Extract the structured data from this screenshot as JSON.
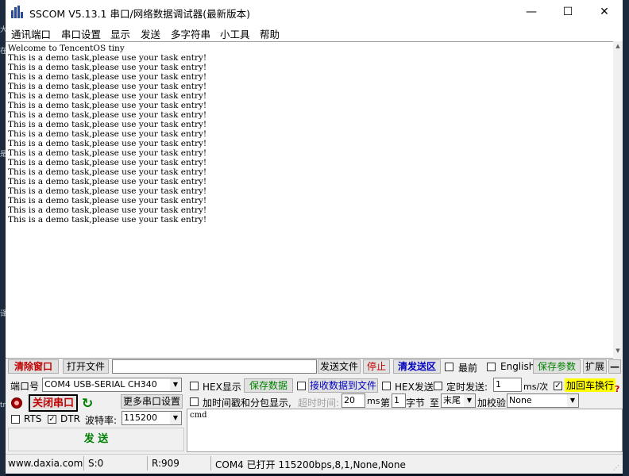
{
  "window": {
    "title": "SSCOM V5.13.1 串口/网络数据调试器(最新版本)",
    "minimize_glyph": "—",
    "maximize_glyph": "☐",
    "close_glyph": "✕"
  },
  "menu": [
    "通讯端口",
    "串口设置",
    "显示",
    "发送",
    "多字符串",
    "小工具",
    "帮助"
  ],
  "terminal": {
    "lines": [
      "Welcome to TencentOS tiny",
      "This is a demo task,please use your task entry!",
      "This is a demo task,please use your task entry!",
      "This is a demo task,please use your task entry!",
      "This is a demo task,please use your task entry!",
      "This is a demo task,please use your task entry!",
      "This is a demo task,please use your task entry!",
      "This is a demo task,please use your task entry!",
      "This is a demo task,please use your task entry!",
      "This is a demo task,please use your task entry!",
      "This is a demo task,please use your task entry!",
      "This is a demo task,please use your task entry!",
      "This is a demo task,please use your task entry!",
      "This is a demo task,please use your task entry!",
      "This is a demo task,please use your task entry!",
      "This is a demo task,please use your task entry!",
      "This is a demo task,please use your task entry!",
      "This is a demo task,please use your task entry!",
      "This is a demo task,please use your task entry!"
    ]
  },
  "toolbar1": {
    "clear_window": "清除窗口",
    "open_file": "打开文件",
    "file_path": "",
    "send_file": "发送文件",
    "stop": "停止",
    "clear_send": "清发送区",
    "front_most": "最前",
    "english": "English",
    "save_params": "保存参数",
    "expand": "扩展",
    "collapse": "—"
  },
  "port": {
    "port_label": "端口号",
    "port_value": "COM4 USB-SERIAL CH340",
    "close_port": "关闭串口",
    "more_settings": "更多串口设置",
    "rts": "RTS",
    "dtr": "DTR",
    "baud_label": "波特率:",
    "baud_value": "115200",
    "send": "发 送"
  },
  "options": {
    "hex_display": "HEX显示",
    "save_data": "保存数据",
    "recv_to_file": "接收数据到文件",
    "hex_send": "HEX发送",
    "timed_send": "定时发送:",
    "interval": "1",
    "interval_unit": "ms/次",
    "crlf": "加回车换行",
    "timestamp": "加时间戳和分包显示,",
    "timeout_label": "超时时间:",
    "timeout_value": "20",
    "ms": "ms",
    "byte_prefix": "第",
    "byte_value": "1",
    "byte_unit": "字节",
    "to_label": "至",
    "to_value": "末尾",
    "checksum_label": "加校验",
    "checksum_value": "None",
    "help_mark": "?"
  },
  "send_text": "cmd",
  "status": {
    "website": "www.daxia.com",
    "sent": "S:0",
    "received": "R:909",
    "port_state": "COM4 已打开  115200bps,8,1,None,None"
  },
  "colors": {
    "red_text": "#c00000",
    "green_text": "#008000",
    "blue_text": "#0000c0",
    "crlf_highlight": "#ffff00"
  }
}
